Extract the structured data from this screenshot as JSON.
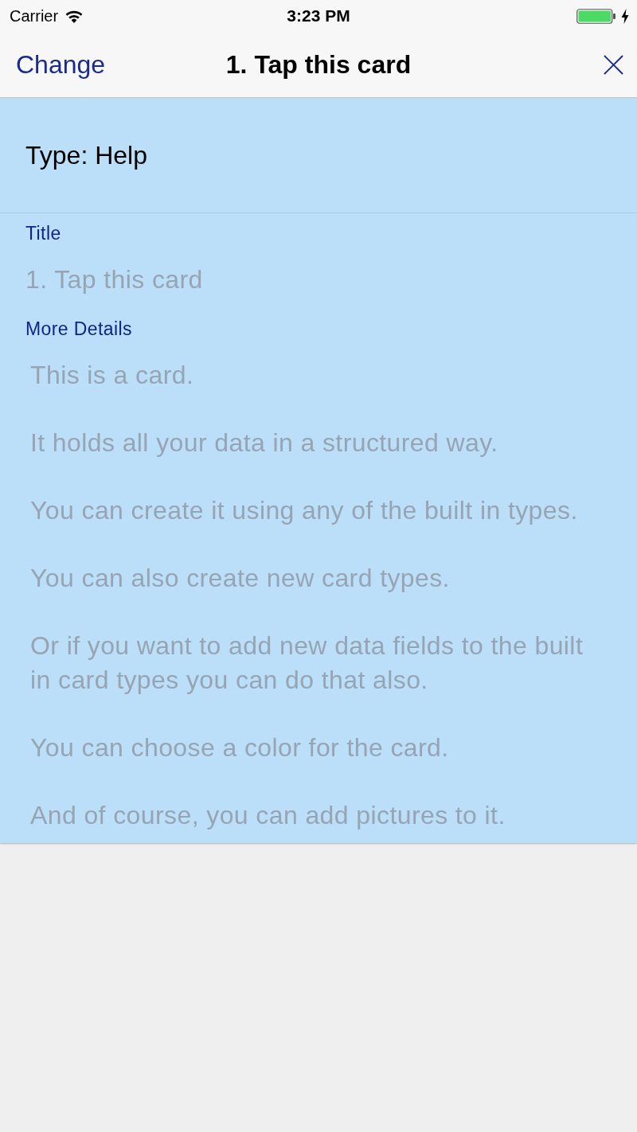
{
  "status_bar": {
    "carrier": "Carrier",
    "time": "3:23 PM"
  },
  "nav_bar": {
    "left_button": "Change",
    "title": "1. Tap this card"
  },
  "card": {
    "type_label": "Type: Help",
    "fields": [
      {
        "kind": "text",
        "label": "Title",
        "value": "1. Tap this card"
      },
      {
        "kind": "multiline",
        "label": "More Details",
        "paragraphs": [
          "This is a card.",
          "It holds all your data in a structured way.",
          "You can create it using any of the built in types.",
          "You can also create new card types.",
          "Or if you want to add new data fields to the built in card types you can do that also.",
          "You can choose a color for the card.",
          "And of course, you can add pictures to it."
        ]
      }
    ]
  }
}
